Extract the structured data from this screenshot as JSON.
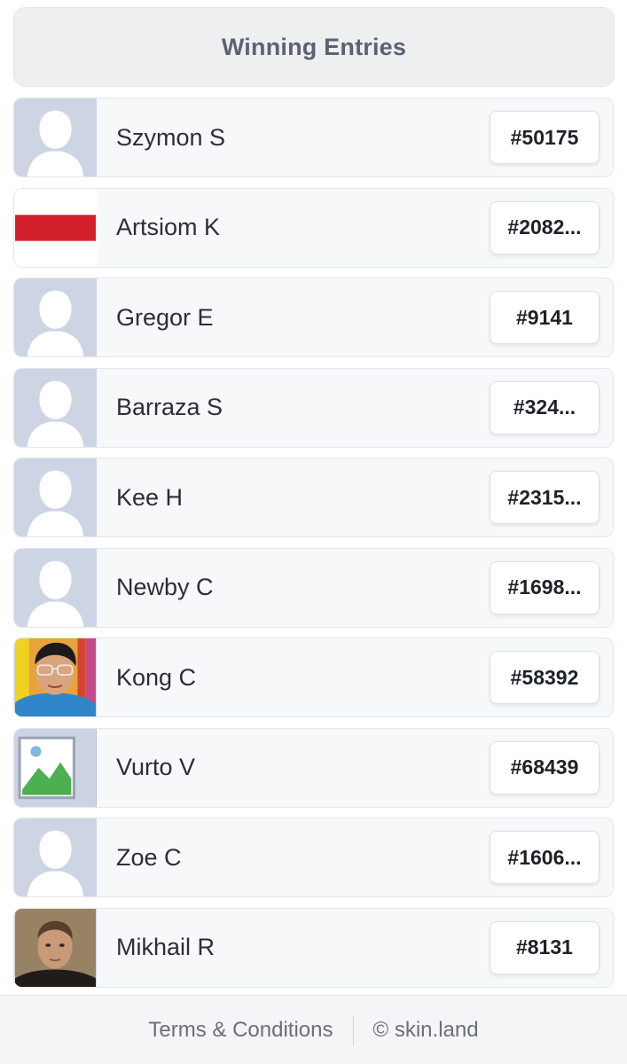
{
  "header": {
    "title": "Winning Entries"
  },
  "entries": [
    {
      "name": "Szymon S",
      "entry": "#50175",
      "avatar": "default-silhouette"
    },
    {
      "name": "Artsiom K",
      "entry": "#2082...",
      "avatar": "white-red-flag"
    },
    {
      "name": "Gregor E",
      "entry": "#9141",
      "avatar": "default-silhouette"
    },
    {
      "name": "Barraza S",
      "entry": "#324...",
      "avatar": "default-silhouette"
    },
    {
      "name": "Kee H",
      "entry": "#2315...",
      "avatar": "default-silhouette"
    },
    {
      "name": "Newby C",
      "entry": "#1698...",
      "avatar": "default-silhouette"
    },
    {
      "name": "Kong C",
      "entry": "#58392",
      "avatar": "photo-person-glasses"
    },
    {
      "name": "Vurto V",
      "entry": "#68439",
      "avatar": "broken-image"
    },
    {
      "name": "Zoe C",
      "entry": "#1606...",
      "avatar": "default-silhouette"
    },
    {
      "name": "Mikhail R",
      "entry": "#8131",
      "avatar": "photo-person"
    }
  ],
  "footer": {
    "terms_label": "Terms & Conditions",
    "copyright": "© skin.land"
  },
  "colors": {
    "header_bg": "#eeeff1",
    "avatar_bg": "#cdd5e5",
    "row_bg": "#f7f8fa"
  }
}
